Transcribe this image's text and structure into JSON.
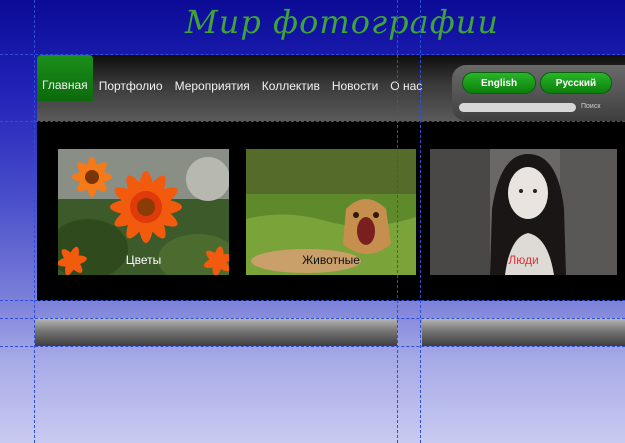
{
  "site": {
    "title": "Мир фотографии"
  },
  "nav": {
    "items": [
      {
        "label": "Главная"
      },
      {
        "label": "Портфолио"
      },
      {
        "label": "Мероприятия"
      },
      {
        "label": "Коллектив"
      },
      {
        "label": "Новости"
      },
      {
        "label": "О нас"
      }
    ]
  },
  "lang": {
    "english": "English",
    "russian": "Русский"
  },
  "search": {
    "label": "Поиск"
  },
  "gallery": {
    "items": [
      {
        "caption": "Цветы",
        "caption_color": "#ffffff"
      },
      {
        "caption": "Животные",
        "caption_color": "#111111"
      },
      {
        "caption": "Люди",
        "caption_color": "#e0303a"
      }
    ]
  },
  "colors": {
    "accent": "#1b8f1b",
    "title": "#3fa23a"
  }
}
